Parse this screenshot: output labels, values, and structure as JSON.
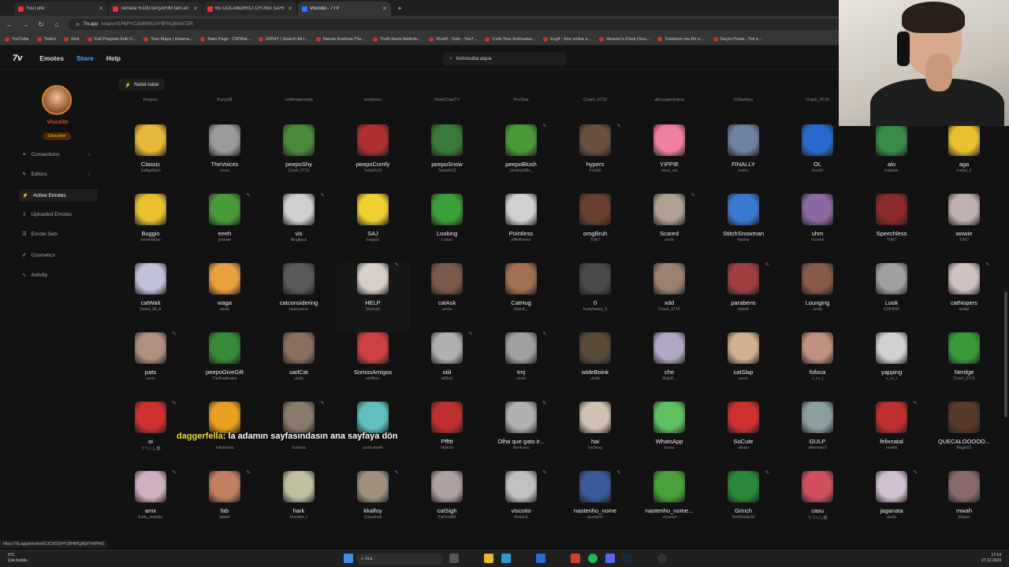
{
  "browser": {
    "tabs": [
      {
        "title": "YouTube",
        "active": false
      },
      {
        "title": "Terraria %100 BAŞARIM tam an",
        "active": false
      },
      {
        "title": "BU DOLANDIRICI OYUNU SAHİ",
        "active": false
      },
      {
        "title": "Viscoito - 7TV",
        "active": true
      }
    ],
    "url_host": "7tv.app",
    "url_path": "/users/01F6PYCJA80001SYBFNQBAN7ZR",
    "bookmarks": [
      "YouTube",
      "Twitch",
      "Kick",
      "Full Program İndir F...",
      "Your Maps | Inkama...",
      "Main Page - CWWat...",
      "GIPHY | Search All t...",
      "Naruto Kushina The...",
      "Truth Hurts Addictiv...",
      "RiveR - Solo - YouT...",
      "Curb Your Enthusias...",
      "Ezgif - free online a...",
      "Heaven's Choir (Sou...",
      "Tutuldum mu Bir e-...",
      "Geçici Posta - Tek k..."
    ]
  },
  "app": {
    "logo": "7v",
    "nav": [
      "Emotes",
      "Store",
      "Help"
    ],
    "search_value": "konosuba aqua",
    "user_chip": "Natal natal"
  },
  "profile": {
    "username": "Viscoito",
    "badge": "Subscriber"
  },
  "sidebar": {
    "items": [
      {
        "label": "Connections",
        "icon": "link-icon",
        "arrow": true
      },
      {
        "label": "Editors",
        "icon": "pencil-icon",
        "arrow": true
      },
      {
        "label": "Active Emotes",
        "icon": "bolt-icon",
        "active": true
      },
      {
        "label": "Uploaded Emotes",
        "icon": "upload-icon"
      },
      {
        "label": "Emote Sets",
        "icon": "stack-icon"
      },
      {
        "label": "Cosmetics",
        "icon": "brush-icon"
      },
      {
        "label": "Activity",
        "icon": "pulse-icon"
      }
    ]
  },
  "header_authors": [
    "Fuepax",
    "Purry38",
    "voidmakesvids",
    "kevinneu",
    "VisterCrazTV",
    "ProTear",
    "Crash_0715",
    "alecsupertramp",
    "DrDankus",
    "Crash_0715"
  ],
  "emotes": [
    [
      {
        "name": "Classic",
        "author": "SirApollyon",
        "color": "#e8b838"
      },
      {
        "name": "TheVoices",
        "author": "uncle",
        "color": "#9a9a9a"
      },
      {
        "name": "peepoShy",
        "author": "Crash_0715",
        "color": "#4a8a3a"
      },
      {
        "name": "peepoComfy",
        "author": "Tanoshi13",
        "color": "#b03030"
      },
      {
        "name": "peepoSnow",
        "author": "Tanoshi13",
        "color": "#3a7a3a"
      },
      {
        "name": "peepoBlush",
        "author": "JeremyIsMe_",
        "color": "#4a9a3a",
        "edit": true
      },
      {
        "name": "hypers",
        "author": "Pochki",
        "color": "#6a5040",
        "edit": true
      },
      {
        "name": "YIPPIE",
        "author": "bluni_val",
        "color": "#f080a0"
      },
      {
        "name": "FINALLY",
        "author": "omiko",
        "color": "#7080a0"
      },
      {
        "name": "OL",
        "author": "kovchi",
        "color": "#2a6ad0"
      }
    ],
    [
      {
        "name": "Buggin",
        "author": "memeladze",
        "color": "#e8c030"
      },
      {
        "name": "eeeh",
        "author": "joooste",
        "color": "#4a9a3a",
        "edit": true
      },
      {
        "name": "vis",
        "author": "Ningbeck",
        "color": "#cfcfcf",
        "edit": true
      },
      {
        "name": "SAJ",
        "author": "Fuepax",
        "color": "#f0d030"
      },
      {
        "name": "Looking",
        "author": "Lodan",
        "color": "#3aa03a"
      },
      {
        "name": "Pointless",
        "author": "pfffeffmeter",
        "color": "#d0d0d0"
      },
      {
        "name": "omgBruh",
        "author": "TUK7",
        "color": "#6a4030"
      },
      {
        "name": "Scared",
        "author": "uncle",
        "color": "#b0a090",
        "edit": true
      },
      {
        "name": "StitchSnowman",
        "author": "Vashiq",
        "color": "#3a7ad0"
      },
      {
        "name": "uhm",
        "author": "Visconi",
        "color": "#8a6aa0"
      }
    ],
    [
      {
        "name": "catWait",
        "author": "David_08_A",
        "color": "#c0c0d8"
      },
      {
        "name": "waga",
        "author": "uncle",
        "color": "#e8a040"
      },
      {
        "name": "catconsidering",
        "author": "marcusrrrs",
        "color": "#5a5a5a"
      },
      {
        "name": "HELP",
        "author": "Shrezno",
        "color": "#d8d0c8",
        "edit": true,
        "highlight": true
      },
      {
        "name": "catAsk",
        "author": "uncle",
        "color": "#7a5a4a"
      },
      {
        "name": "CatHug",
        "author": "RainiF_",
        "color": "#a07050"
      },
      {
        "name": "0",
        "author": "frostyfawxy_9",
        "color": "#4a4a4a"
      },
      {
        "name": "xdd",
        "author": "Crash_0715",
        "color": "#9a8070"
      },
      {
        "name": "parabens",
        "author": "lateefl",
        "color": "#a04040",
        "edit": true
      },
      {
        "name": "Lounging",
        "author": "uncle",
        "color": "#8a5a4a"
      }
    ],
    [
      {
        "name": "pats",
        "author": "uncle",
        "color": "#b09080",
        "edit": true
      },
      {
        "name": "peepoGiveGift",
        "author": "TheFradinator",
        "color": "#3a8a3a"
      },
      {
        "name": "sadCat",
        "author": "uncle",
        "color": "#8a7060"
      },
      {
        "name": "SomosAmigos",
        "author": "enHilian",
        "color": "#d04040"
      },
      {
        "name": "oiiii",
        "author": "xdSud",
        "color": "#b0b0b0",
        "edit": true
      },
      {
        "name": "tmj",
        "author": "uncle",
        "color": "#a0a0a0",
        "edit": true
      },
      {
        "name": "wideBoink",
        "author": "uncle",
        "color": "#5a4a3a"
      },
      {
        "name": "che",
        "author": "RainiF_",
        "color": "#b0a8c0"
      },
      {
        "name": "catSlap",
        "author": "uncle",
        "color": "#d0b090"
      },
      {
        "name": "fofoca",
        "author": "v_cn_t",
        "color": "#c09080",
        "edit": true
      }
    ],
    [
      {
        "name": "oi",
        "author": "うつくし鶴",
        "color": "#d03030",
        "edit": true
      },
      {
        "name": "",
        "author": "milytancia",
        "color": "#e8a020"
      },
      {
        "name": "",
        "author": "Korlana",
        "color": "#8a7a6a",
        "edit": true
      },
      {
        "name": "",
        "author": "penkuineek",
        "color": "#60c0c0"
      },
      {
        "name": "Pffttt",
        "author": "NickVo",
        "color": "#c03030"
      },
      {
        "name": "Olha que gato ir...",
        "author": "Benkona",
        "color": "#b0b0b0",
        "edit": true
      },
      {
        "name": "hai",
        "author": "IvySoup",
        "color": "#d0c0b0"
      },
      {
        "name": "WhatsApp",
        "author": "kyura",
        "color": "#60c060"
      },
      {
        "name": "SoCute",
        "author": "ztkaru",
        "color": "#d03030"
      },
      {
        "name": "GULP",
        "author": "athernals7",
        "color": "#8aa0a0"
      }
    ],
    [
      {
        "name": "amx",
        "author": "Eddy_asdnjks",
        "color": "#d0b0c0",
        "edit": true
      },
      {
        "name": "fab",
        "author": "lateefl",
        "color": "#c08060",
        "edit": true
      },
      {
        "name": "hark",
        "author": "brenden_l",
        "color": "#c0c0a0"
      },
      {
        "name": "kkalfoy",
        "author": "Curseitool",
        "color": "#a09080",
        "edit": true
      },
      {
        "name": "catSigh",
        "author": "FisDroidM",
        "color": "#b0a0a0"
      },
      {
        "name": "viscoito",
        "author": "Relan1t",
        "color": "#c0c0c0",
        "edit": true
      },
      {
        "name": "naotenho_nome",
        "author": "queephh",
        "color": "#3a5a9a",
        "edit": true
      },
      {
        "name": "naotenho_nome...",
        "author": "vicsesei",
        "color": "#4aa03a"
      },
      {
        "name": "Grinch",
        "author": "NorthSideLW",
        "color": "#2a8a3a",
        "edit": true
      },
      {
        "name": "casu",
        "author": "うつくし鶴",
        "color": "#d05060"
      }
    ]
  ],
  "right_column": [
    {
      "name": "alo",
      "author": "lvatarek",
      "color": "#3a8a4a"
    },
    {
      "name": "Speechless",
      "author": "TUK7",
      "color": "#8a2a2a"
    },
    {
      "name": "Look",
      "author": "GISHINY",
      "color": "#a0a0a0"
    },
    {
      "name": "yapping",
      "author": "v_cn_t",
      "color": "#d0d0d0"
    },
    {
      "name": "felixnatal",
      "author": "noxlitii",
      "color": "#c03030",
      "edit": true
    },
    {
      "name": "jaganata",
      "author": "uncle",
      "color": "#d0c0d0",
      "edit": true
    }
  ],
  "far_right_column": [
    {
      "name": "aga",
      "author": "melos_2",
      "color": "#e8c030"
    },
    {
      "name": "wowie",
      "author": "TUK7",
      "color": "#c0b0b0"
    },
    {
      "name": "catNopers",
      "author": "wolfpf",
      "color": "#d0c0c0",
      "edit": true
    },
    {
      "name": "Nerdge",
      "author": "Crash_0715",
      "color": "#3a9a3a"
    },
    {
      "name": "QUECALOOOOO...",
      "author": "Magik52",
      "color": "#5a3a2a"
    },
    {
      "name": "mwah",
      "author": "Eleans",
      "color": "#8a6a6a"
    }
  ],
  "subtitle": {
    "highlight": "daggerfella",
    "text": ": la adamın sayfasındasın ana sayfaya dön"
  },
  "status_url": "https://7tv.app/emotes/01JC0D324Y1BH80QA0IIT4XPWZ",
  "taskbar": {
    "weather_temp": "0°C",
    "weather_desc": "Çok bulutlu",
    "search_placeholder": "Ara",
    "time": "17:14",
    "date": "27.12.2023"
  }
}
